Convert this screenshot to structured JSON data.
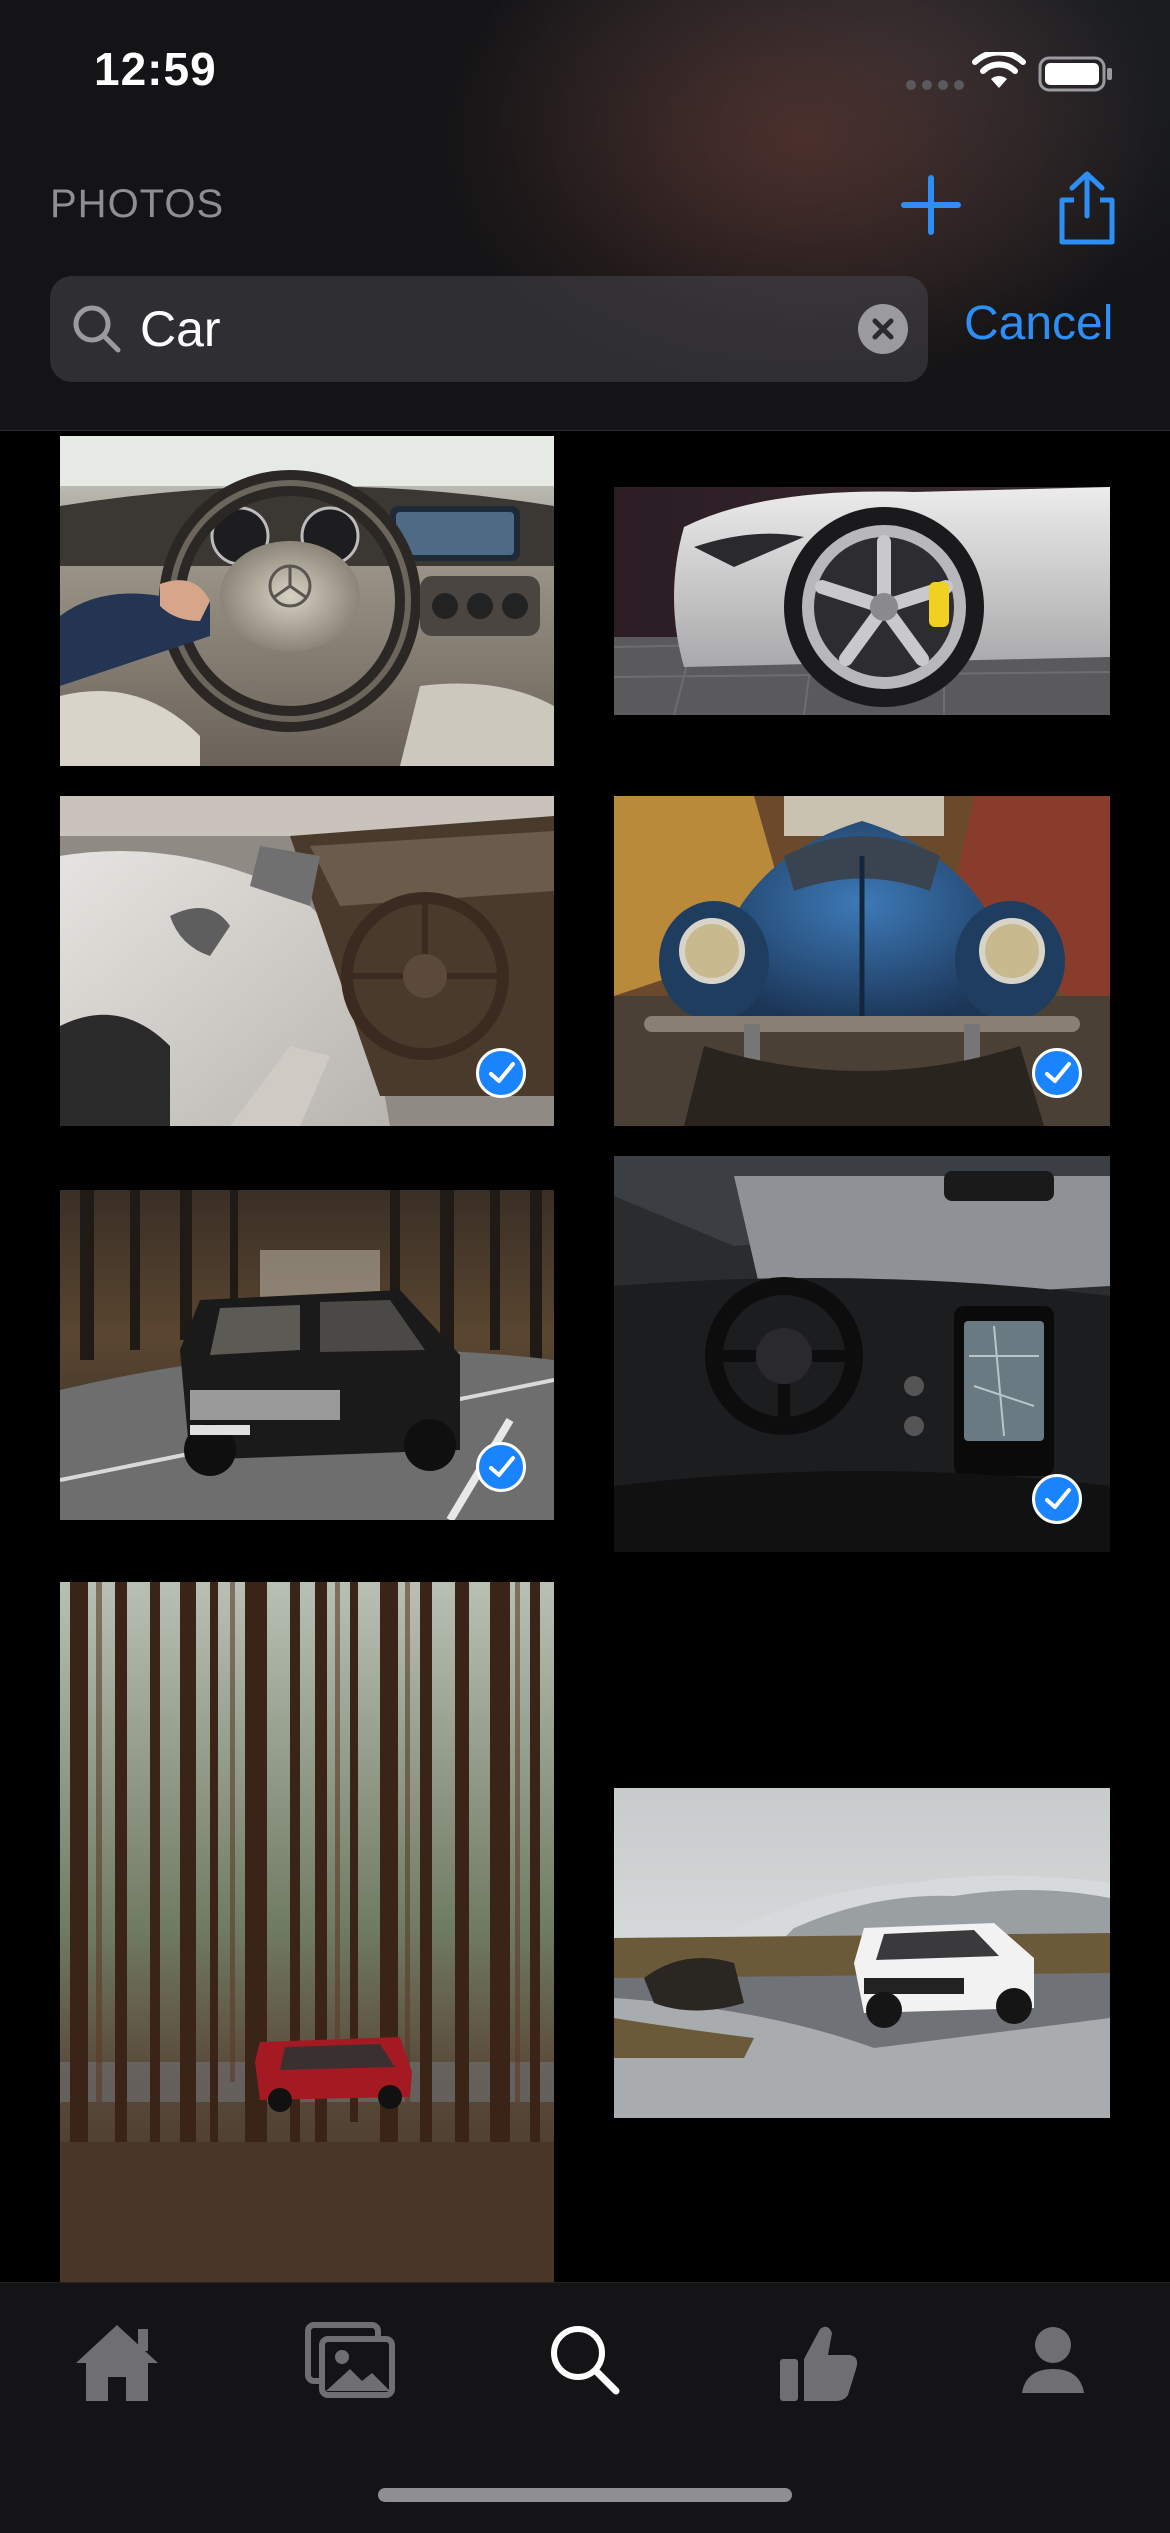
{
  "status_bar": {
    "time": "12:59"
  },
  "header": {
    "title": "PHOTOS"
  },
  "search": {
    "value": "Car",
    "cancel_label": "Cancel"
  },
  "colors": {
    "accent": "#2d8ff5",
    "check": "#1a84ff",
    "background": "#000000"
  },
  "photos": [
    {
      "subject": "car interior steering wheel",
      "selected": false
    },
    {
      "subject": "silver sports car wheel",
      "selected": false
    },
    {
      "subject": "white classic car interior",
      "selected": true
    },
    {
      "subject": "blue vintage beetle",
      "selected": true
    },
    {
      "subject": "black suv on road",
      "selected": true
    },
    {
      "subject": "modern truck dashboard",
      "selected": true
    },
    {
      "subject": "red car in pine forest",
      "selected": false
    },
    {
      "subject": "white suv on icy plain",
      "selected": false
    }
  ],
  "tabs": [
    {
      "icon": "home-icon",
      "active": false
    },
    {
      "icon": "photos-icon",
      "active": false
    },
    {
      "icon": "search-icon",
      "active": true
    },
    {
      "icon": "thumbs-up-icon",
      "active": false
    },
    {
      "icon": "profile-icon",
      "active": false
    }
  ]
}
